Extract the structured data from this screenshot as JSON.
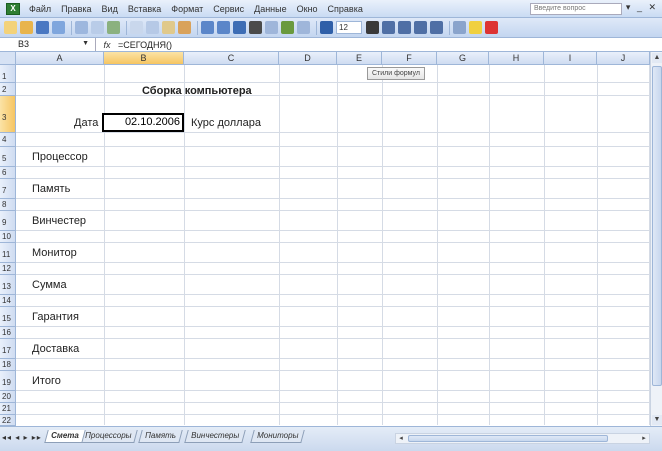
{
  "menubar": {
    "items": [
      "Файл",
      "Правка",
      "Вид",
      "Вставка",
      "Формат",
      "Сервис",
      "Данные",
      "Окно",
      "Справка"
    ],
    "help_placeholder": "Введите вопрос"
  },
  "toolbar": {
    "font_size": "12"
  },
  "formulabar": {
    "name_box": "B3",
    "fx": "fx",
    "formula": "=СЕГОДНЯ()"
  },
  "columns": [
    "A",
    "B",
    "C",
    "D",
    "E",
    "F",
    "G",
    "H",
    "I",
    "J"
  ],
  "rows": [
    "1",
    "2",
    "3",
    "4",
    "5",
    "6",
    "7",
    "8",
    "9",
    "10",
    "11",
    "12",
    "13",
    "14",
    "15",
    "16",
    "17",
    "18",
    "19",
    "20",
    "21",
    "22"
  ],
  "sheet": {
    "title": "Сборка компьютера",
    "date_label": "Дата",
    "date_value": "02.10.2006",
    "rate_label": "Курс доллара",
    "labels": {
      "r5": "Процессор",
      "r7": "Память",
      "r9": "Винчестер",
      "r11": "Монитор",
      "r13": "Сумма",
      "r15": "Гарантия",
      "r17": "Доставка",
      "r19": "Итого"
    },
    "floating_button": "Стили формул"
  },
  "tabs": [
    "Смета",
    "Процессоры",
    "Память",
    "Винчестеры",
    "Мониторы"
  ],
  "active_tab": "Смета"
}
